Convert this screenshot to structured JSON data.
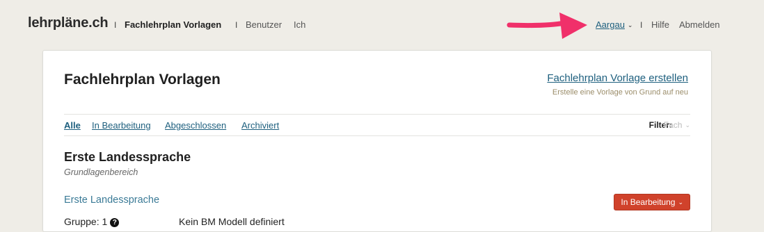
{
  "brand": "lehrpläne.ch",
  "nav": {
    "active": "Fachlehrplan Vorlagen",
    "benutzer": "Benutzer",
    "ich": "Ich",
    "separator": "I"
  },
  "user_nav": {
    "canton": "Aargau",
    "hilfe": "Hilfe",
    "abmelden": "Abmelden"
  },
  "main": {
    "title": "Fachlehrplan Vorlagen",
    "create_link": "Fachlehrplan Vorlage erstellen",
    "create_hint": "Erstelle eine Vorlage von Grund auf neu",
    "tabs": [
      "Alle",
      "In Bearbeitung",
      "Abgeschlossen",
      "Archiviert"
    ],
    "filter_label": "Filter:",
    "filter_value": "Fach"
  },
  "section": {
    "title": "Erste Landessprache",
    "subtitle": "Grundlagenbereich",
    "item_title": "Erste Landessprache",
    "status": "In Bearbeitung",
    "group_label": "Gruppe: 1",
    "model_text": "Kein BM Modell definiert"
  },
  "colors": {
    "background": "#efede7",
    "link": "#1d5f7e",
    "status_button": "#d0422b",
    "annotation_arrow": "#f0306a"
  },
  "icons": [
    "chevron-down-icon",
    "help-icon",
    "annotation-arrow-icon"
  ]
}
